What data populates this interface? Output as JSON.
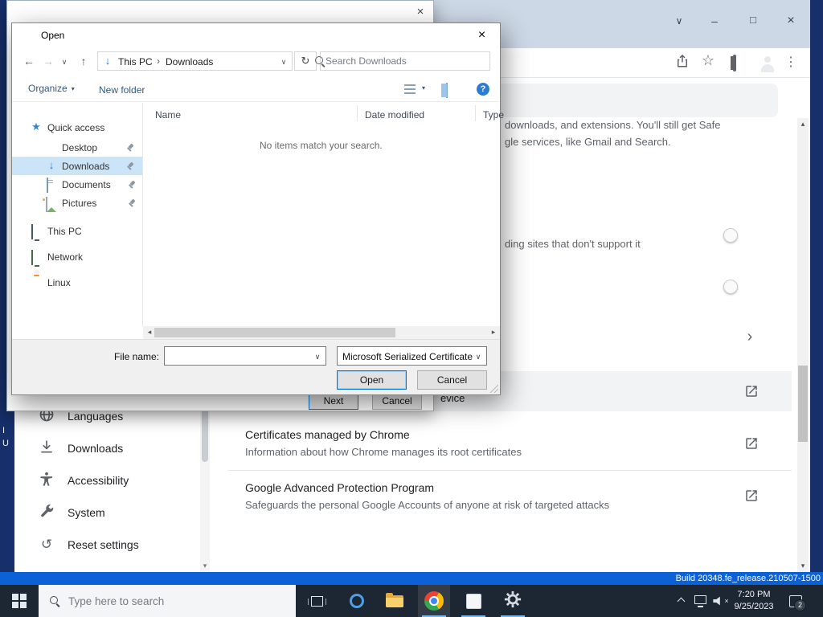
{
  "icons": {
    "close": "×",
    "minimize": "–",
    "maximize": "□",
    "window_chevron": "∨",
    "back": "←",
    "forward": "→",
    "up": "↑",
    "refresh": "↻",
    "caret_down": "▾",
    "dropdown_chevron": "∨",
    "crumb_sep": "›",
    "kebab": "⋮",
    "star": "☆",
    "chevron_right": "›",
    "scroll_left": "◂",
    "scroll_right": "▸",
    "scroll_up": "▴",
    "scroll_down": "▾",
    "quick_access_star": "★",
    "download_arrow": "↓",
    "help": "?",
    "reset": "↺"
  },
  "desktop": {
    "letter1": "I",
    "letter2": "U",
    "build": "Build 20348.fe_release.210507-1500"
  },
  "browser": {
    "settings": {
      "fragment_line1": "downloads, and extensions. You'll still get Safe",
      "fragment_line2": "gle services, like Gmail and Search.",
      "fragment_https": "ding sites that don't support it",
      "fragment_device": "evice",
      "cards": [
        {
          "title": "Certificates managed by Chrome",
          "subtitle": "Information about how Chrome manages its root certificates"
        },
        {
          "title": "Google Advanced Protection Program",
          "subtitle": "Safeguards the personal Google Accounts of anyone at risk of targeted attacks"
        }
      ],
      "nav": [
        "Languages",
        "Downloads",
        "Accessibility",
        "System",
        "Reset settings"
      ]
    }
  },
  "wizard": {
    "next": "Next",
    "cancel": "Cancel"
  },
  "dialog": {
    "title": "Open",
    "crumb_pc": "This PC",
    "crumb_folder": "Downloads",
    "search_placeholder": "Search Downloads",
    "organize": "Organize",
    "new_folder": "New folder",
    "quick_access": "Quick access",
    "pinned": [
      "Desktop",
      "Downloads",
      "Documents",
      "Pictures"
    ],
    "this_pc": "This PC",
    "network": "Network",
    "linux": "Linux",
    "col_name": "Name",
    "col_date": "Date modified",
    "col_type": "Type",
    "empty": "No items match your search.",
    "file_name_label": "File name:",
    "file_name_value": "",
    "file_type": "Microsoft Serialized Certificate",
    "open": "Open",
    "cancel": "Cancel"
  },
  "taskbar": {
    "search_placeholder": "Type here to search",
    "time": "7:20 PM",
    "date": "9/25/2023",
    "badge": "2"
  }
}
